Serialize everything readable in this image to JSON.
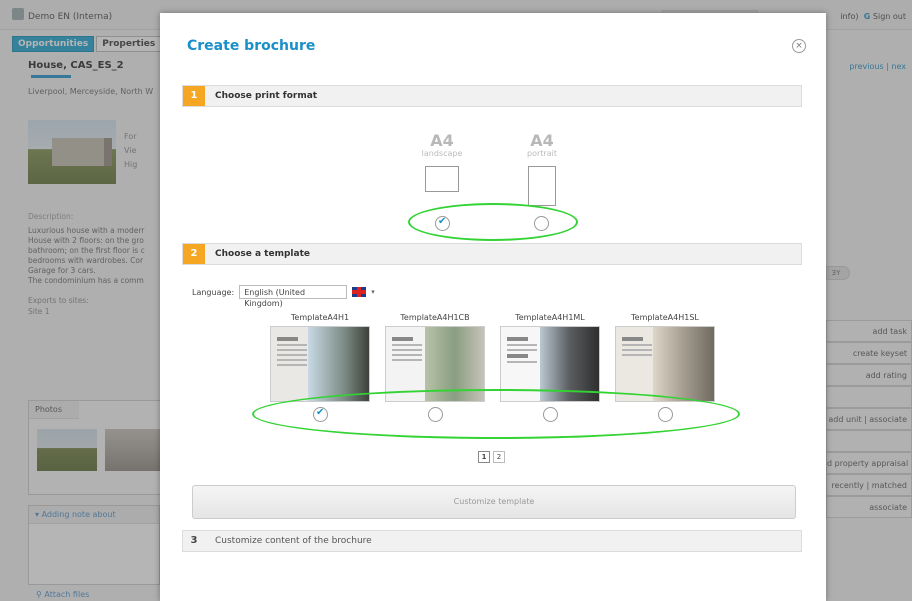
{
  "background": {
    "app_title": "Demo EN (Interna)",
    "top_links": {
      "info": "info)",
      "signout": "Sign out"
    },
    "tabs": [
      "Opportunities",
      "Properties"
    ],
    "property": {
      "title": "House, CAS_ES_2",
      "location": "Liverpool, Merceyside, North W",
      "info_lines": [
        "For",
        "Vie",
        "Hig"
      ]
    },
    "description_label": "Description:",
    "description_lines": [
      "Luxurious house with a moderr",
      "House with 2 floors: on the gro",
      "bathroom; on the first floor is c",
      "bedrooms with wardrobes. Cor",
      "Garage for 3 cars.",
      "The condominium has a comm"
    ],
    "exports_label": "Exports to sites:",
    "exports_value": "Site 1",
    "photos_label": "Photos",
    "note_label": "Adding note about",
    "attach_files": "Attach files",
    "nav_links": "previous | nex",
    "pill_text": "3Y",
    "actions": [
      "add task",
      "create keyset",
      "add rating",
      "",
      "add unit | associate",
      "",
      "d property appraisal",
      "recently | matched",
      "associate"
    ]
  },
  "modal": {
    "title": "Create brochure",
    "close_icon": "×",
    "step1": {
      "number": "1",
      "label": "Choose print format"
    },
    "formats": [
      {
        "size": "A4",
        "orientation": "landscape",
        "selected": true
      },
      {
        "size": "A4",
        "orientation": "portrait",
        "selected": false
      }
    ],
    "step2": {
      "number": "2",
      "label": "Choose a template"
    },
    "language": {
      "label": "Language:",
      "value": "English (United Kingdom)"
    },
    "templates": [
      {
        "name": "TemplateA4H1",
        "selected": true
      },
      {
        "name": "TemplateA4H1CB",
        "selected": false
      },
      {
        "name": "TemplateA4H1ML",
        "selected": false
      },
      {
        "name": "TemplateA4H1SL",
        "selected": false
      }
    ],
    "pagination": [
      "1",
      "2"
    ],
    "customize_button": "Customize template",
    "step3": {
      "number": "3",
      "label": "Customize content of the brochure"
    }
  },
  "colors": {
    "accent": "#1a8fc9",
    "step_badge": "#f5a623",
    "highlight_ellipse": "#34d334"
  }
}
